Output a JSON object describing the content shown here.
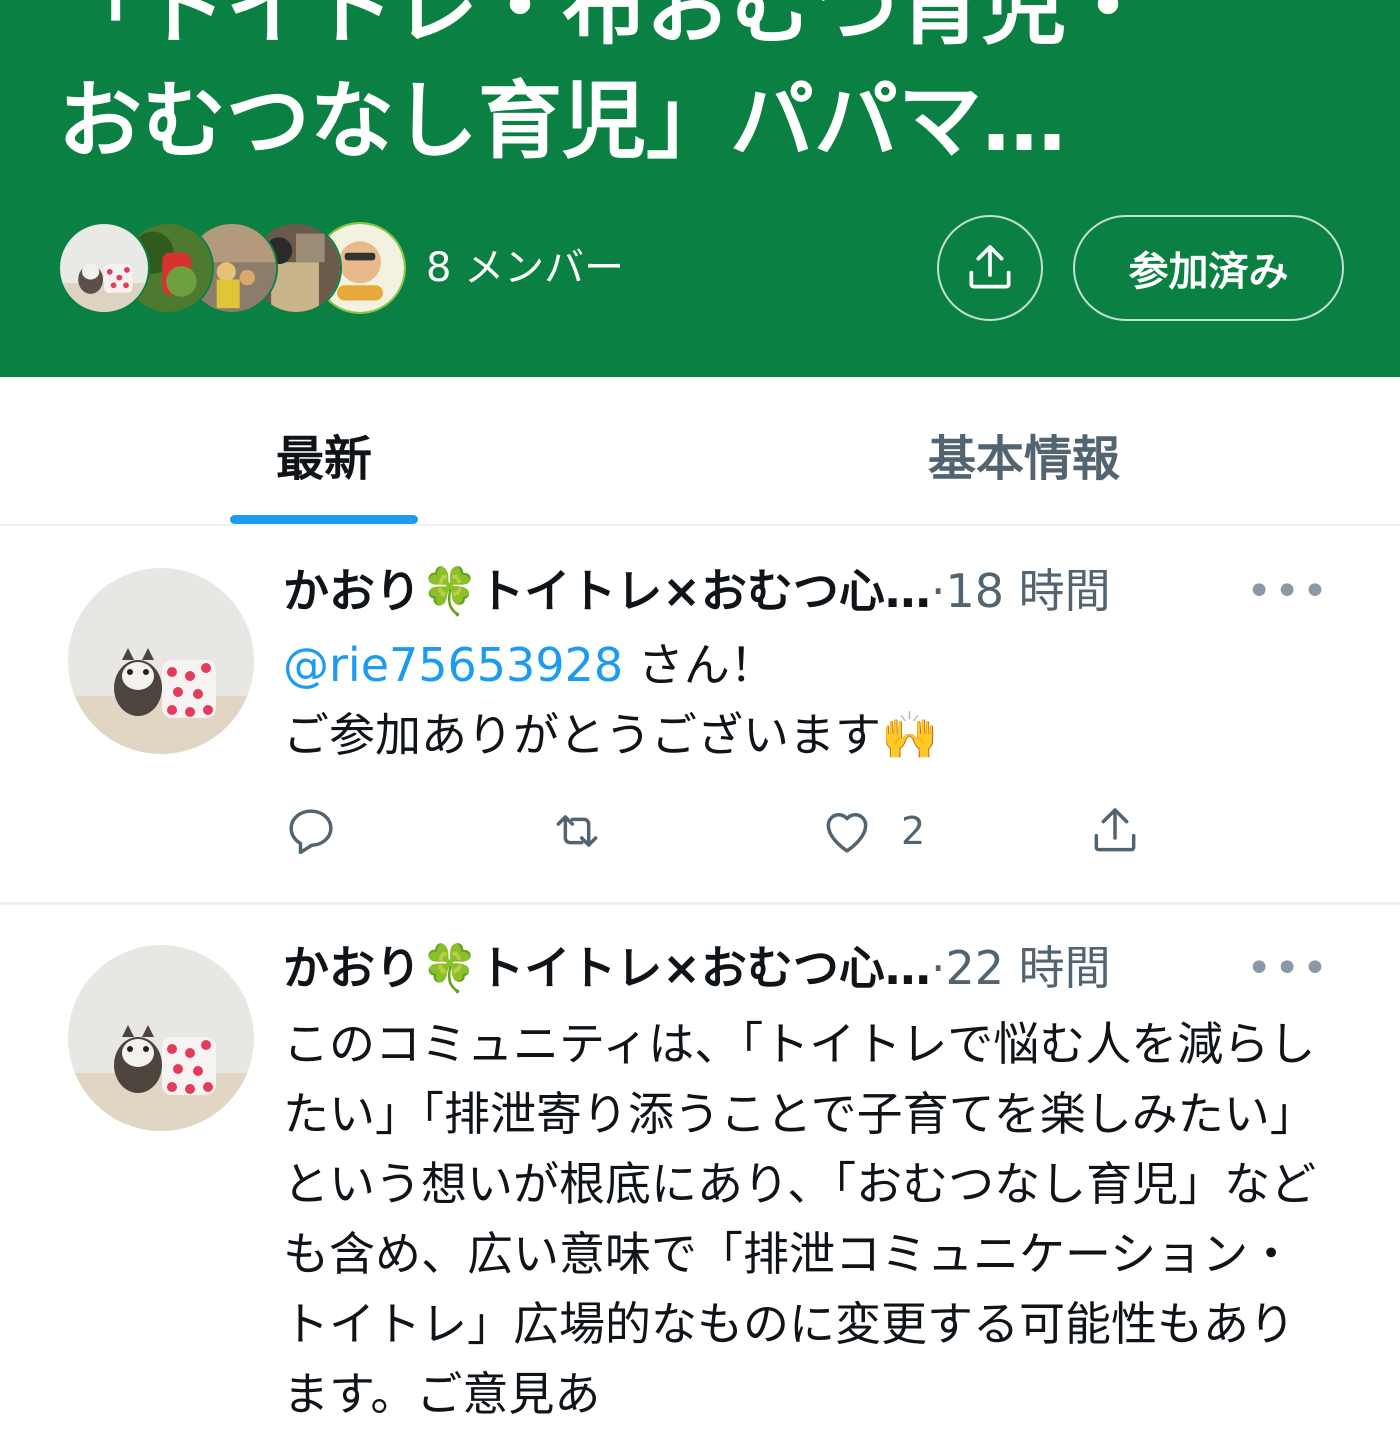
{
  "community": {
    "title_line1": "「トイトレ・布おむつ育児・",
    "title_line2": "おむつなし育児」パパマ…",
    "member_count": "8 メンバー",
    "share_icon": "share-icon",
    "joined_label": "参加済み",
    "header_color": "#0b8043"
  },
  "tabs": {
    "latest": "最新",
    "about": "基本情報",
    "active": "最新",
    "indicator_color": "#1d9bf0"
  },
  "tweets": [
    {
      "name": "かおり🍀トイトレ×おむつ心…",
      "dot": "·",
      "time": "18 時間",
      "more": "•••",
      "mention": "@rie75653928",
      "mention_suffix": " さん！",
      "line2": "ご参加ありがとうございます🙌",
      "likes": "2"
    },
    {
      "name": "かおり🍀トイトレ×おむつ心…",
      "dot": "·",
      "time": "22 時間",
      "more": "•••",
      "body": "このコミュニティは、「トイトレで悩む人を減らしたい」「排泄寄り添うことで子育てを楽しみたい」という想いが根底にあり、「おむつなし育児」なども含め、広い意味で「排泄コミュニケーション・トイトレ」広場的なものに変更する可能性もあります。ご意見あ"
    }
  ]
}
